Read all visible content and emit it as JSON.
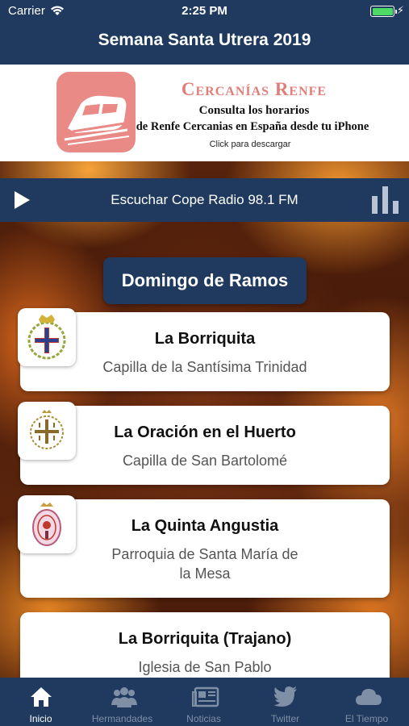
{
  "status_bar": {
    "carrier": "Carrier",
    "time": "2:25 PM",
    "battery_color": "#4cd964"
  },
  "nav": {
    "title": "Semana Santa Utrera 2019",
    "bar_color": "#1f3a5e"
  },
  "ad": {
    "brand": "Cercanías Renfe",
    "line1": "Consulta los horarios",
    "line2": "de Renfe Cercanias en España desde tu iPhone",
    "cta": "Click para descargar",
    "icon": "train-icon",
    "icon_color": "#e98a86"
  },
  "radio": {
    "label": "Escuchar Cope Radio 98.1 FM",
    "play_icon": "play-icon",
    "bars_icon": "audio-bars-icon"
  },
  "section": {
    "title": "Domingo de Ramos"
  },
  "cards": [
    {
      "title": "La Borriquita",
      "subtitle": "Capilla de la Santísima Trinidad",
      "crest": "trinitarian-cross-crest-icon"
    },
    {
      "title": "La Oración en el Huerto",
      "subtitle": "Capilla de San Bartolomé",
      "crest": "jerusalem-cross-crest-icon"
    },
    {
      "title": "La Quinta Angustia",
      "subtitle_line1": "Parroquia de Santa María de",
      "subtitle_line2": "la Mesa",
      "crest": "oval-coat-of-arms-icon"
    },
    {
      "title": "La Borriquita (Trajano)",
      "subtitle": "Iglesia de San Pablo"
    }
  ],
  "tabbar": {
    "items": [
      {
        "label": "Inicio",
        "icon": "home-icon",
        "active": true
      },
      {
        "label": "Hermandades",
        "icon": "people-icon",
        "active": false
      },
      {
        "label": "Noticias",
        "icon": "newspaper-icon",
        "active": false
      },
      {
        "label": "Twitter",
        "icon": "twitter-bird-icon",
        "active": false
      },
      {
        "label": "El Tiempo",
        "icon": "cloud-icon",
        "active": false
      }
    ]
  }
}
